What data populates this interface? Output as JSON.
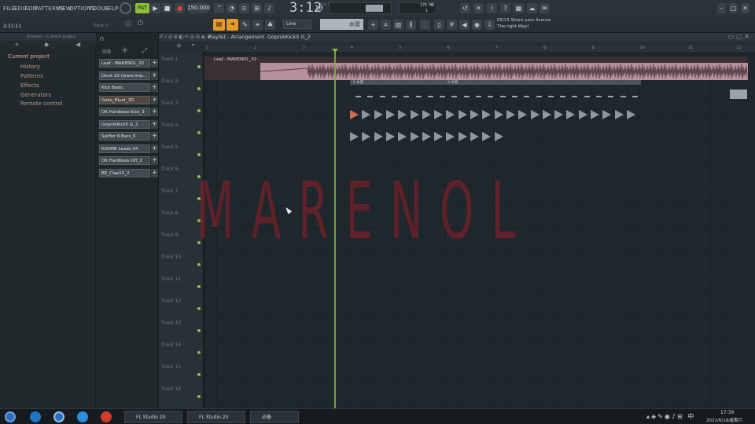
{
  "menu": [
    "FILE",
    "EDIT",
    "ADD",
    "PATTERNS",
    "VIEW",
    "OPTIONS",
    "TOOLS",
    "HELP"
  ],
  "transport": {
    "tempo": "150.000",
    "time": "3:12",
    "time_sub": "10",
    "time_unit": "B:S:T"
  },
  "cpu": {
    "mem": "175 MB",
    "poly": "1"
  },
  "hint": {
    "line1": "05/15  Share your license",
    "line2": "The right Way!"
  },
  "hint_counter": "05/15",
  "status_left": "2:11:11",
  "status_track": "Track 3",
  "snap": {
    "label": "Line",
    "pattern": "水管"
  },
  "browser": {
    "header": "Browser - Current project",
    "items": [
      "Current project",
      "History",
      "Patterns",
      "Effects",
      "Generators",
      "Remote control"
    ]
  },
  "playlist": {
    "title": "Playlist - Arrangement",
    "pattern": "GopnikKick5 G_2"
  },
  "channels": [
    "Leaf - MARENOL_32",
    "Donk 20 (www.tmp...",
    "Kick Basic",
    "Geka_Blyat_3D",
    "OK Hardbass Kick_3",
    "GopnikKick5 G_2",
    "Spiffer 8 Bars_6",
    "KSHMR Leads 04",
    "OK Hardbass OH_2",
    "BE_Clap15_2"
  ],
  "tracks": [
    "Track 1",
    "Track 2",
    "Track 3",
    "Track 4",
    "Track 5",
    "Track 6",
    "Track 7",
    "Track 8",
    "Track 9",
    "Track 10",
    "Track 11",
    "Track 12",
    "Track 13",
    "Track 14",
    "Track 15",
    "Track 16"
  ],
  "ruler": [
    "1",
    "2",
    "3",
    "4",
    "5",
    "6",
    "7",
    "8",
    "9",
    "10",
    "11",
    "12"
  ],
  "clips": {
    "audio": "Leaf - MARENOL_32",
    "pattern_a": "2  水管",
    "pattern_b": "3  水管"
  },
  "watermark": "MARENOL",
  "taskbar": {
    "apps": [
      "FL Studio 20",
      "FL Studio 20",
      "必备"
    ],
    "time": "17:39",
    "date": "2022/6/18/星期六"
  },
  "colors": {
    "accent": "#e59a2c",
    "playhead": "#7fb83a",
    "watermark": "#8a1e28"
  }
}
